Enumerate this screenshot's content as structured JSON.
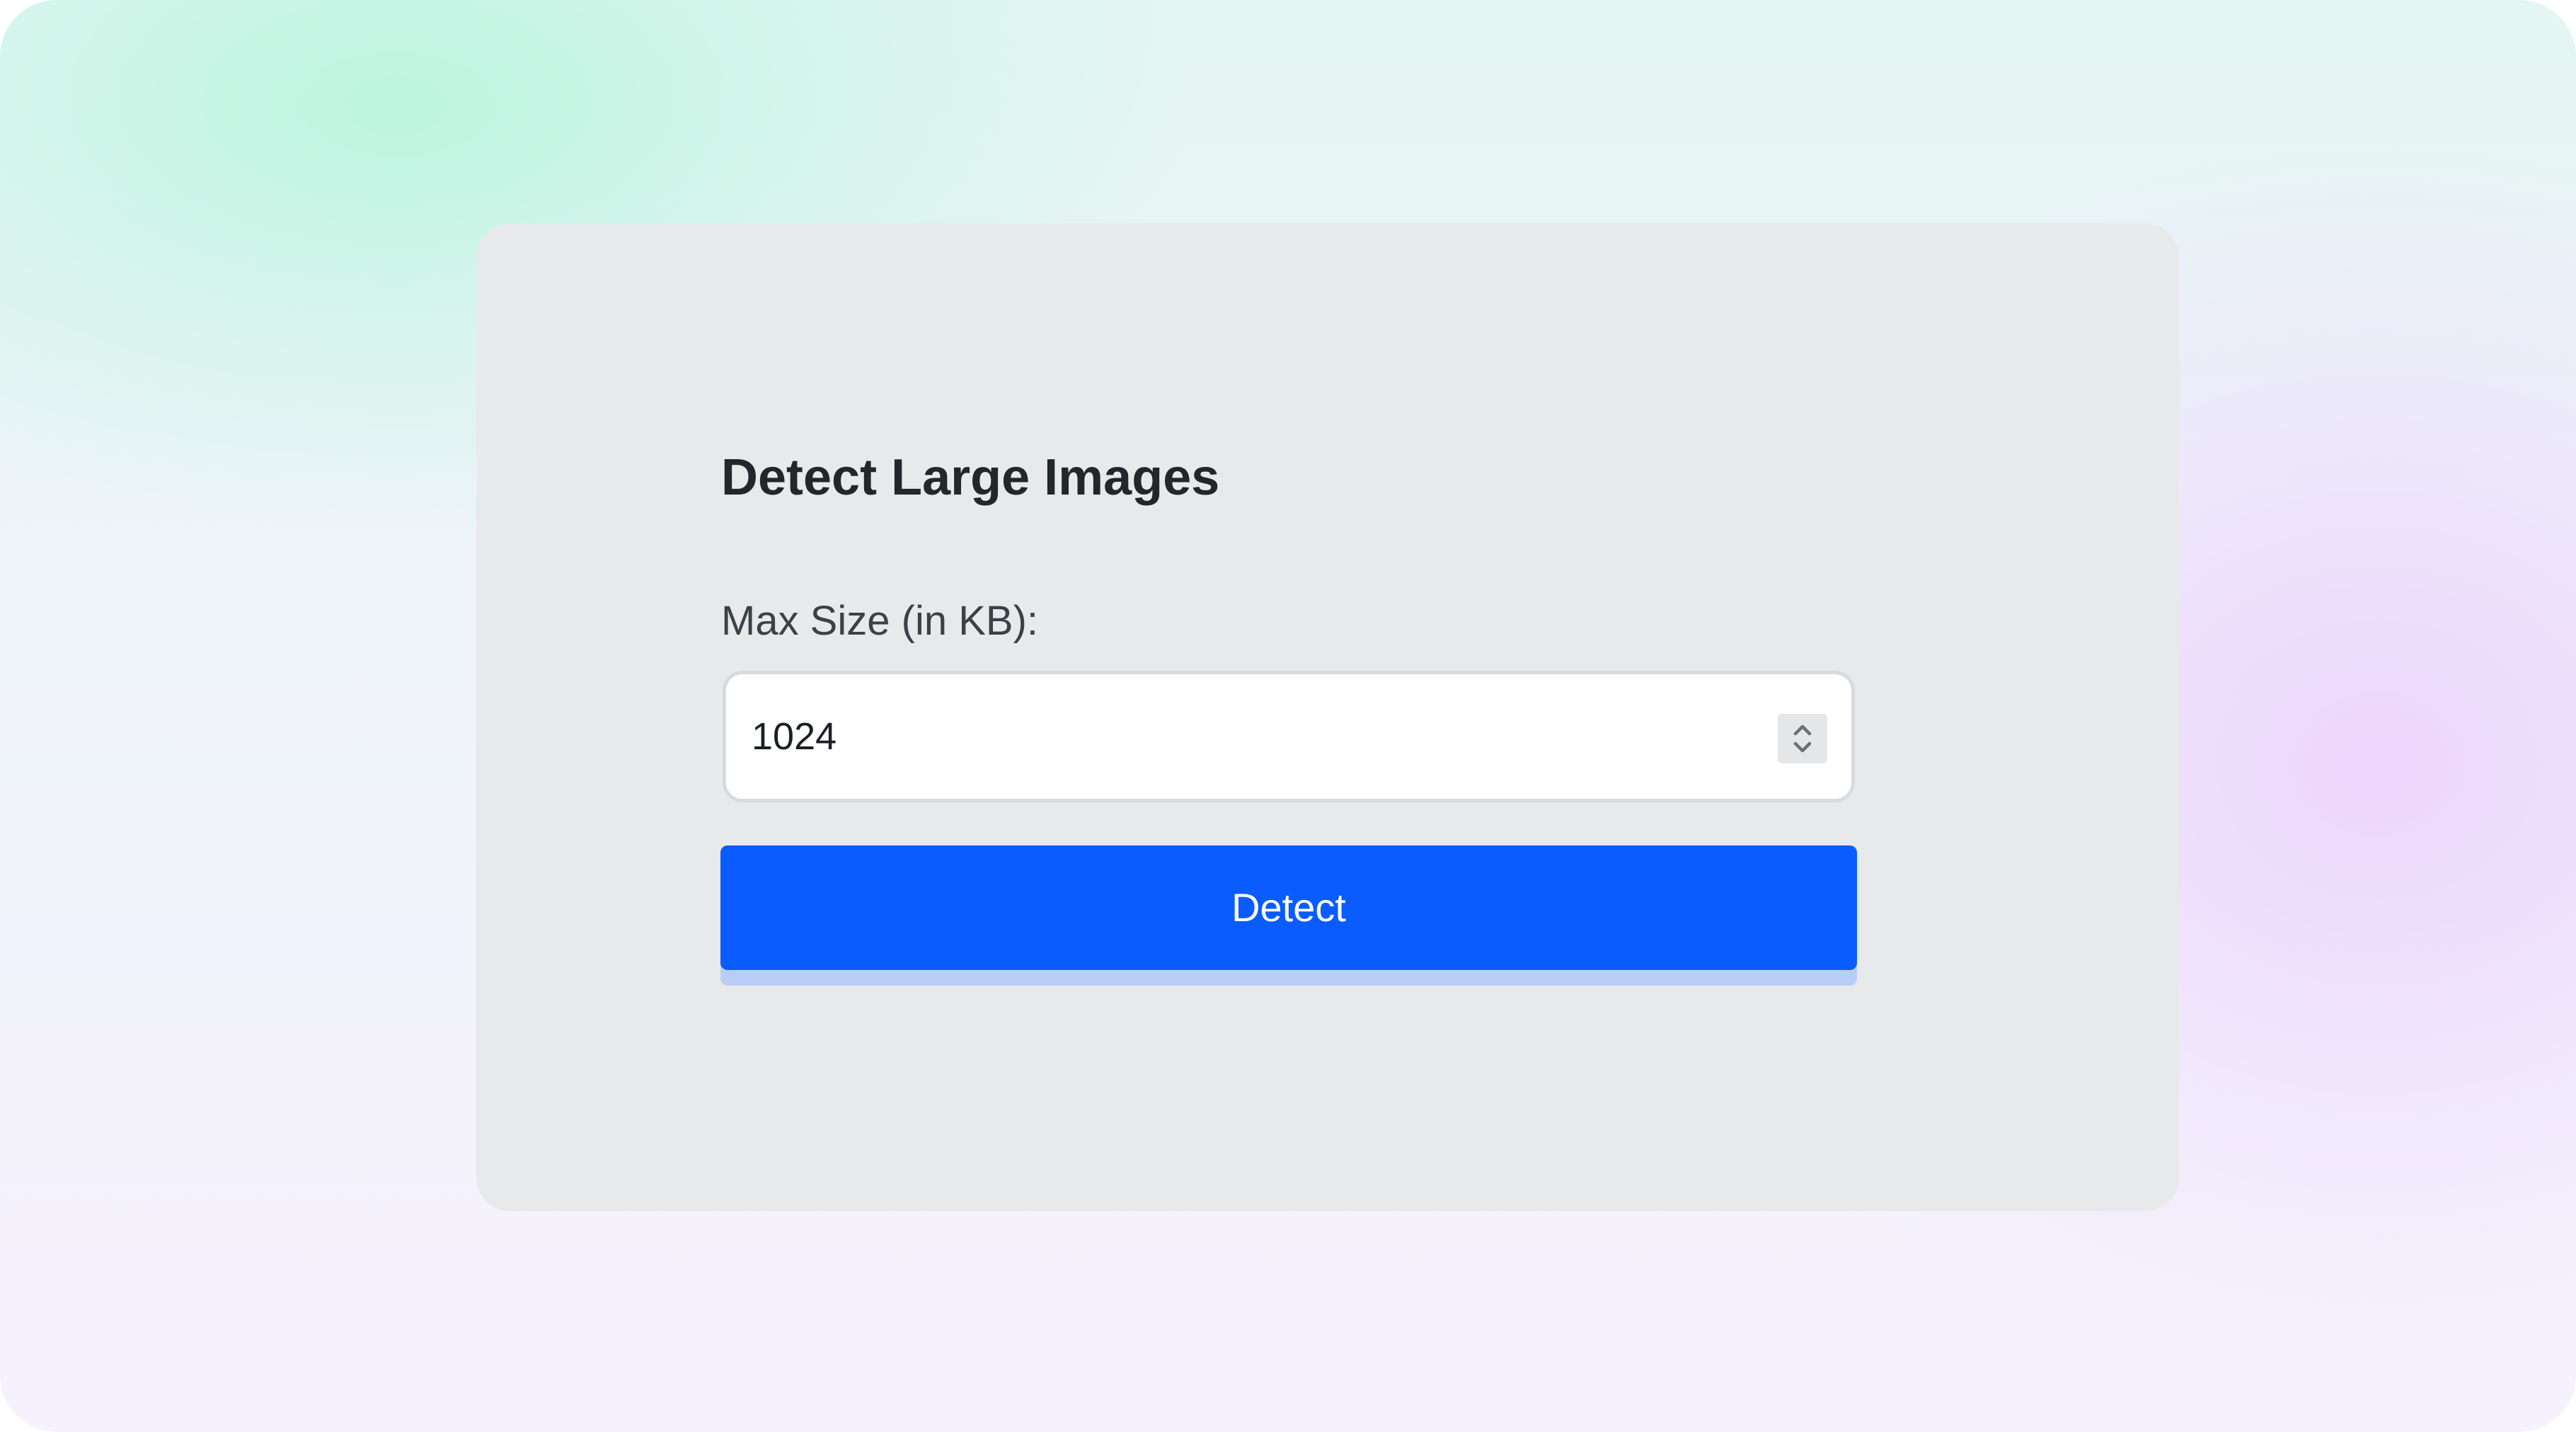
{
  "form": {
    "title": "Detect Large Images",
    "max_size_label": "Max Size (in KB):",
    "max_size_value": "1024",
    "stepper_icon": "up-down-chevron-icon",
    "detect_label": "Detect"
  },
  "colors": {
    "primary_button": "#0a5cff",
    "card_background": "#e8e9eb",
    "title_text": "#23262b"
  }
}
